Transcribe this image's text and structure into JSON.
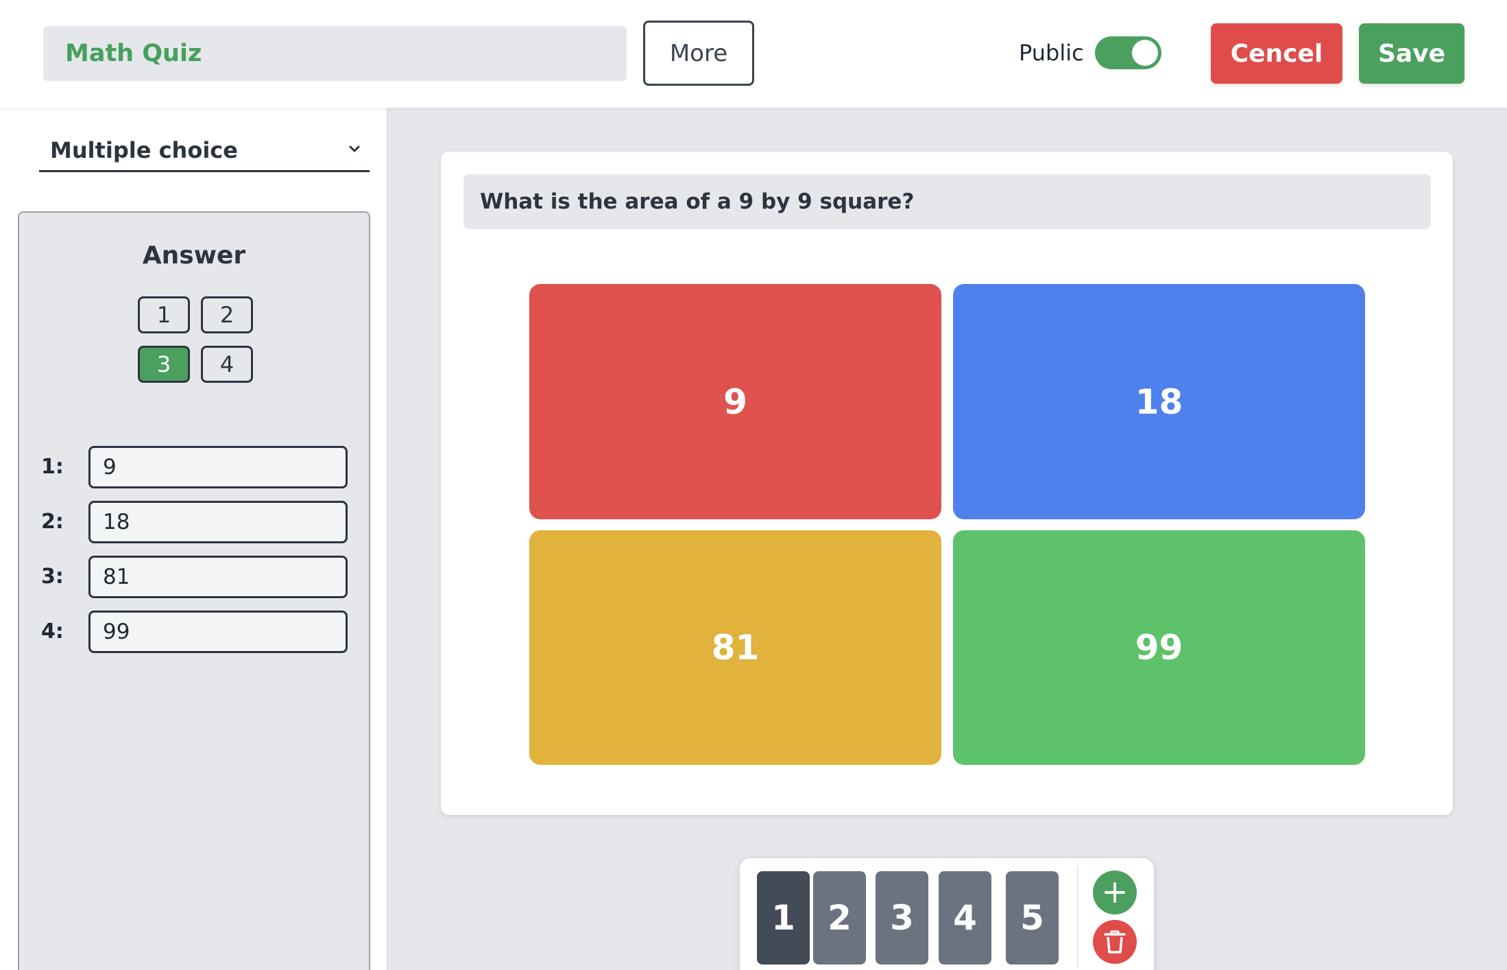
{
  "header": {
    "quiz_title": "Math Quiz",
    "more_label": "More",
    "public_label": "Public",
    "public_enabled": true,
    "cancel_label": "Cencel",
    "save_label": "Save"
  },
  "sidebar": {
    "question_type": "Multiple choice",
    "answer_heading": "Answer",
    "answer_buttons": [
      "1",
      "2",
      "3",
      "4"
    ],
    "selected_answer": "3",
    "options": [
      {
        "label": "1:",
        "value": "9"
      },
      {
        "label": "2:",
        "value": "18"
      },
      {
        "label": "3:",
        "value": "81"
      },
      {
        "label": "4:",
        "value": "99"
      }
    ]
  },
  "main": {
    "question": "What is the area of a 9 by 9 square?",
    "choices": [
      {
        "text": "9",
        "color": "#df524d"
      },
      {
        "text": "18",
        "color": "#4f80ec"
      },
      {
        "text": "81",
        "color": "#e1b33d"
      },
      {
        "text": "99",
        "color": "#5dc269"
      }
    ]
  },
  "slides": {
    "items": [
      "1",
      "2",
      "3",
      "4",
      "5"
    ],
    "active": "1",
    "add_icon": "plus-icon",
    "delete_icon": "trash-icon"
  },
  "colors": {
    "accent_green": "#4ca05f",
    "danger_red": "#df4c4a",
    "background": "#e5e7eb"
  }
}
